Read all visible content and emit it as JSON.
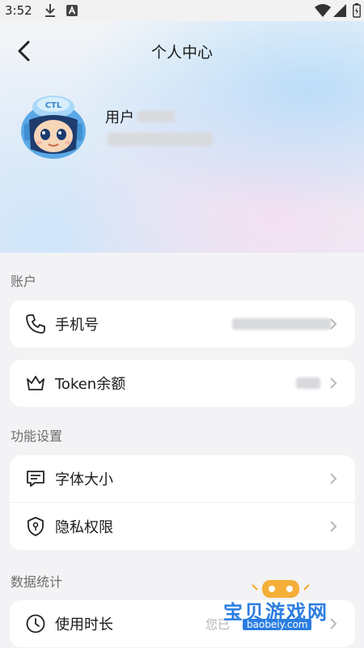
{
  "status_bar": {
    "time": "3:52",
    "icons": [
      "download-icon",
      "notification-a-icon",
      "wifi-icon",
      "signal-icon",
      "battery-icon"
    ]
  },
  "header": {
    "title": "个人中心",
    "back_icon": "chevron-left-icon"
  },
  "profile": {
    "name_prefix": "用户"
  },
  "sections": [
    {
      "label": "账户",
      "cards": [
        {
          "rows": [
            {
              "icon": "phone-icon",
              "label": "手机号"
            }
          ]
        },
        {
          "rows": [
            {
              "icon": "crown-icon",
              "label": "Token余额"
            }
          ]
        }
      ]
    },
    {
      "label": "功能设置",
      "cards": [
        {
          "rows": [
            {
              "icon": "message-box-icon",
              "label": "字体大小"
            },
            {
              "icon": "shield-lock-icon",
              "label": "隐私权限"
            }
          ]
        }
      ]
    },
    {
      "label": "数据统计",
      "cards": [
        {
          "rows": [
            {
              "icon": "clock-icon",
              "label": "使用时长",
              "value_prefix": "您已"
            }
          ]
        }
      ]
    }
  ],
  "watermark": {
    "text": "宝贝游戏网",
    "url": "baobeiy.com"
  },
  "colors": {
    "accent_blue": "#2a7de1",
    "page_bg": "#f3f3f5",
    "card_bg": "#ffffff"
  }
}
